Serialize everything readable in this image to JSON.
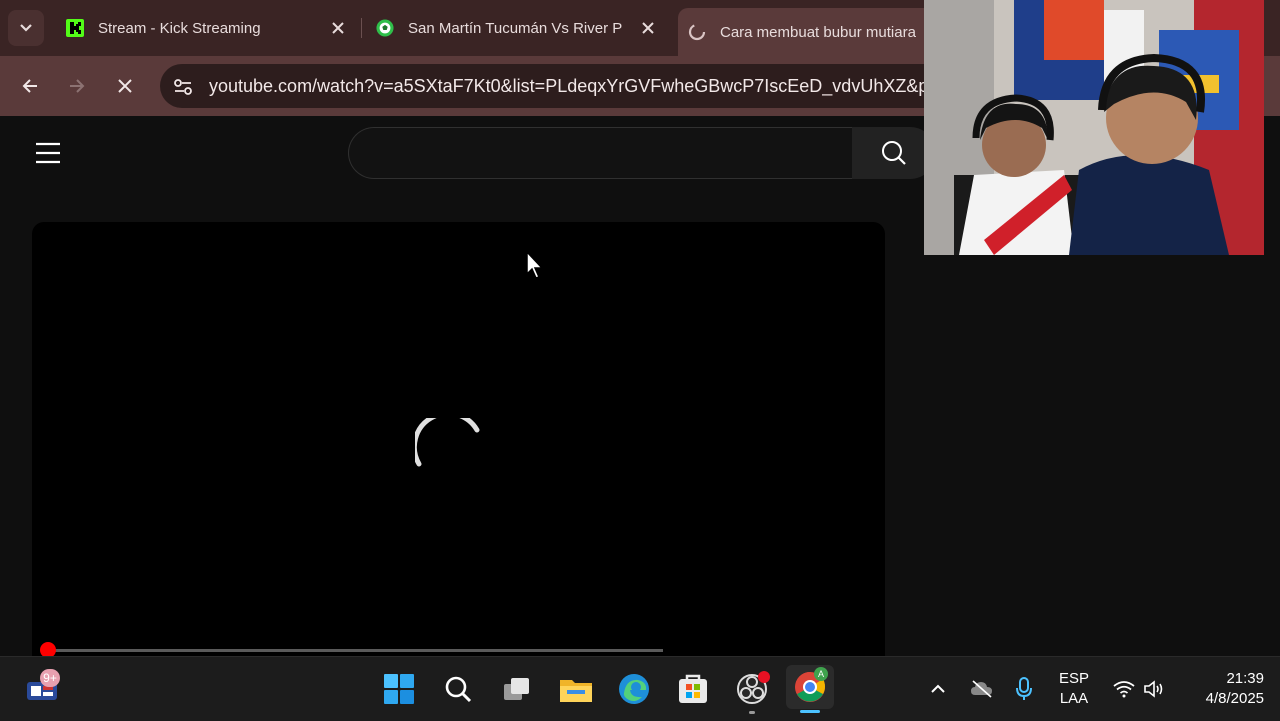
{
  "browser": {
    "tabs": [
      {
        "title": "Stream - Kick Streaming",
        "icon": "kick-icon"
      },
      {
        "title": "San Martín Tucumán Vs River P",
        "icon": "soccer-ball-icon"
      },
      {
        "title": "Cara membuat bubur mutiara",
        "icon": "loading-icon",
        "active": true
      }
    ],
    "url": "youtube.com/watch?v=a5SXtaF7Kt0&list=PLdeqxYrGVFwheGBwcP7IscEeD_vdvUhXZ&p"
  },
  "youtube": {
    "search": {
      "placeholder": "",
      "value": ""
    },
    "player": {
      "state": "loading",
      "progress_fraction": 0.0
    }
  },
  "webcam": {
    "description_hidden": true
  },
  "taskbar": {
    "apps": [
      "windows-start-icon",
      "search-icon",
      "task-view-icon",
      "file-explorer-icon",
      "edge-icon",
      "store-icon",
      "obs-icon",
      "chrome-icon"
    ],
    "widget_badge": "9+",
    "language": {
      "line1": "ESP",
      "line2": "LAA"
    },
    "clock": {
      "time": "21:39",
      "date": "4/8/2025"
    }
  },
  "colors": {
    "accent": "#ff0000",
    "tabstrip": "#3a2424",
    "toolbar": "#5a3a3a"
  }
}
